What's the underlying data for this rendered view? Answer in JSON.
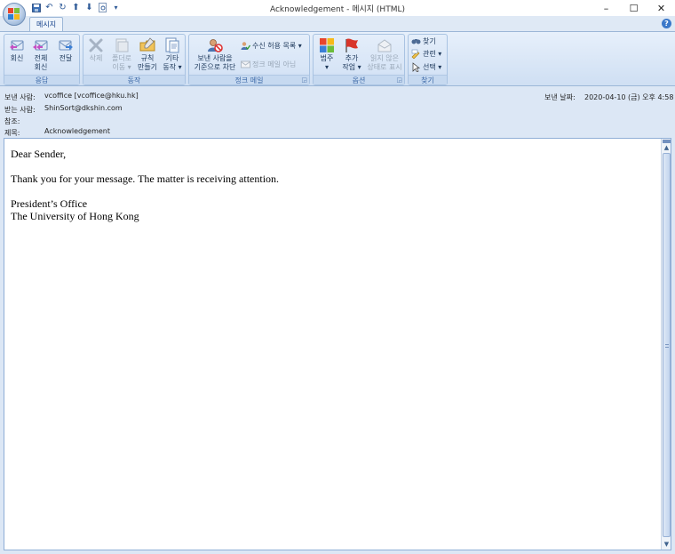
{
  "window": {
    "title": "Acknowledgement - 메시지 (HTML)",
    "controls": {
      "minimize": "–",
      "maximize": "☐",
      "close": "✕"
    }
  },
  "qat": {
    "items": [
      "save-icon",
      "undo-icon",
      "redo-icon",
      "up-icon",
      "down-icon",
      "print-preview-icon",
      "customize-icon"
    ]
  },
  "tabs": [
    {
      "label": "메시지",
      "active": true
    }
  ],
  "ribbon": {
    "groups": [
      {
        "label": "응답",
        "buttons": [
          {
            "label1": "회신",
            "label2": "",
            "icon": "reply-icon"
          },
          {
            "label1": "전체",
            "label2": "회신",
            "icon": "reply-all-icon"
          },
          {
            "label1": "전달",
            "label2": "",
            "icon": "forward-icon"
          }
        ]
      },
      {
        "label": "동작",
        "buttons": [
          {
            "label1": "삭제",
            "label2": "",
            "icon": "delete-icon",
            "disabled": true
          },
          {
            "label1": "폴더로",
            "label2": "이동 ▾",
            "icon": "move-to-folder-icon",
            "disabled": true
          },
          {
            "label1": "규칙",
            "label2": "만들기",
            "icon": "create-rule-icon"
          },
          {
            "label1": "기타",
            "label2": "동작 ▾",
            "icon": "other-actions-icon"
          }
        ]
      },
      {
        "label": "정크 메일",
        "buttons": [
          {
            "label1": "보낸 사람을",
            "label2": "기준으로 차단",
            "icon": "block-sender-icon"
          }
        ],
        "small": [
          {
            "label": "수신 허용 목록 ▾",
            "icon": "safe-list-icon"
          },
          {
            "label": "정크 메일 아님",
            "icon": "not-junk-icon",
            "disabled": true
          }
        ]
      },
      {
        "label": "옵션",
        "buttons": [
          {
            "label1": "범주",
            "label2": "▾",
            "icon": "categorize-icon"
          },
          {
            "label1": "추가",
            "label2": "작업 ▾",
            "icon": "follow-up-flag-icon"
          },
          {
            "label1": "읽지 않은",
            "label2": "상태로 표시",
            "icon": "mark-unread-icon",
            "disabled": true
          }
        ]
      },
      {
        "label": "찾기",
        "small": [
          {
            "label": "찾기",
            "icon": "find-icon"
          },
          {
            "label": "관련 ▾",
            "icon": "related-icon"
          },
          {
            "label": "선택 ▾",
            "icon": "select-icon"
          }
        ]
      }
    ]
  },
  "header": {
    "from_label": "보낸 사람:",
    "from_value": "vcoffice [vcoffice@hku.hk]",
    "to_label": "받는 사람:",
    "to_value": "ShinSort@dkshin.com",
    "cc_label": "참조:",
    "cc_value": "",
    "subject_label": "제목:",
    "subject_value": "Acknowledgement",
    "sent_label": "보낸 날짜:",
    "sent_value": "2020-04-10 (금) 오후 4:58"
  },
  "message": {
    "greeting": "Dear Sender,",
    "body": "Thank you for your message.  The matter is receiving attention.",
    "signature_line1": "President’s Office",
    "signature_line2": "The University of Hong Kong"
  },
  "colors": {
    "accent": "#15428b",
    "ribbon_bg": "#dce7f5",
    "header_bg": "#dce7f5"
  }
}
